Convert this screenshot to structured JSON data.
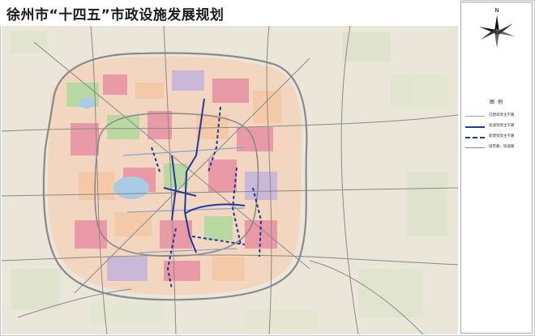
{
  "title": "徐州市“十四五”市政设施发展规划",
  "north_label": "N",
  "legend": {
    "title": "图 例",
    "items": [
      {
        "label": "已建高架主干路",
        "style": "existing"
      },
      {
        "label": "高速架架主干路",
        "style": "built"
      },
      {
        "label": "新建架架主干路",
        "style": "new"
      },
      {
        "label": "城市路、快速路",
        "style": "road"
      }
    ]
  },
  "colors": {
    "ring_road": "#8a8a8a",
    "elevated_built": "#1f3a9e",
    "elevated_existing": "#8fa3c7",
    "landuse_residential": "#f4c9a8",
    "landuse_commercial": "#e99aa6",
    "landuse_green": "#b9d9a3",
    "landuse_industrial": "#c9b8d8",
    "landuse_water": "#a9cbe6",
    "background_farmland": "#eae6da"
  }
}
